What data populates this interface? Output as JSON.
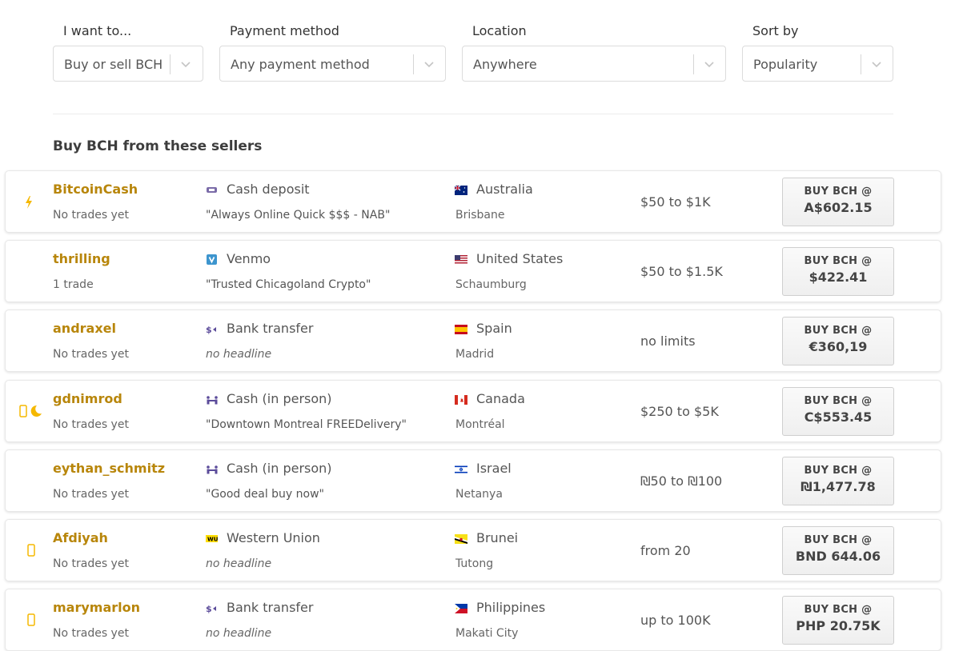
{
  "filters": [
    {
      "label": "I want to...",
      "value": "Buy or sell BCH"
    },
    {
      "label": "Payment method",
      "value": "Any payment method"
    },
    {
      "label": "Location",
      "value": "Anywhere"
    },
    {
      "label": "Sort by",
      "value": "Popularity"
    }
  ],
  "section_title": "Buy BCH from these sellers",
  "colors": {
    "seller": "#b8860b",
    "status_icon": "#f5b800"
  },
  "offers": [
    {
      "status_icon": "lightning-icon",
      "seller": "BitcoinCash",
      "trades": "No trades yet",
      "pm_icon": "cash-deposit-icon",
      "payment_method": "Cash deposit",
      "headline": "\"Always Online Quick $$$ - NAB\"",
      "flag": "australia-flag-icon",
      "country": "Australia",
      "city": "Brisbane",
      "limits": "$50 to $1K",
      "buy_label": "BUY BCH @",
      "price": "A$602.15"
    },
    {
      "status_icon": "",
      "seller": "thrilling",
      "trades": "1 trade",
      "pm_icon": "venmo-icon",
      "payment_method": "Venmo",
      "headline": "\"Trusted Chicagoland Crypto\"",
      "flag": "us-flag-icon",
      "country": "United States",
      "city": "Schaumburg",
      "limits": "$50 to $1.5K",
      "buy_label": "BUY BCH @",
      "price": "$422.41"
    },
    {
      "status_icon": "",
      "seller": "andraxel",
      "trades": "No trades yet",
      "pm_icon": "bank-transfer-icon",
      "payment_method": "Bank transfer",
      "headline": "no headline",
      "flag": "spain-flag-icon",
      "country": "Spain",
      "city": "Madrid",
      "limits": "no limits",
      "buy_label": "BUY BCH @",
      "price": "€360,19"
    },
    {
      "status_icon": "phone-moon-icon",
      "seller": "gdnimrod",
      "trades": "No trades yet",
      "pm_icon": "cash-in-person-icon",
      "payment_method": "Cash (in person)",
      "headline": "\"Downtown Montreal FREEDelivery\"",
      "flag": "canada-flag-icon",
      "country": "Canada",
      "city": "Montréal",
      "limits": "$250 to $5K",
      "buy_label": "BUY BCH @",
      "price": "C$553.45"
    },
    {
      "status_icon": "",
      "seller": "eythan_schmitz",
      "trades": "No trades yet",
      "pm_icon": "cash-in-person-icon",
      "payment_method": "Cash (in person)",
      "headline": "\"Good deal buy now\"",
      "flag": "israel-flag-icon",
      "country": "Israel",
      "city": "Netanya",
      "limits": "₪50 to ₪100",
      "buy_label": "BUY BCH @",
      "price": "₪1,477.78"
    },
    {
      "status_icon": "phone-icon",
      "seller": "Afdiyah",
      "trades": "No trades yet",
      "pm_icon": "western-union-icon",
      "payment_method": "Western Union",
      "headline": "no headline",
      "flag": "brunei-flag-icon",
      "country": "Brunei",
      "city": "Tutong",
      "limits": "from  20",
      "buy_label": "BUY BCH @",
      "price": "BND 644.06"
    },
    {
      "status_icon": "phone-icon",
      "seller": "marymarlon",
      "trades": "No trades yet",
      "pm_icon": "bank-transfer-icon",
      "payment_method": "Bank transfer",
      "headline": "no headline",
      "flag": "philippines-flag-icon",
      "country": "Philippines",
      "city": "Makati City",
      "limits": "up to  100K",
      "buy_label": "BUY BCH @",
      "price": "PHP 20.75K"
    }
  ]
}
